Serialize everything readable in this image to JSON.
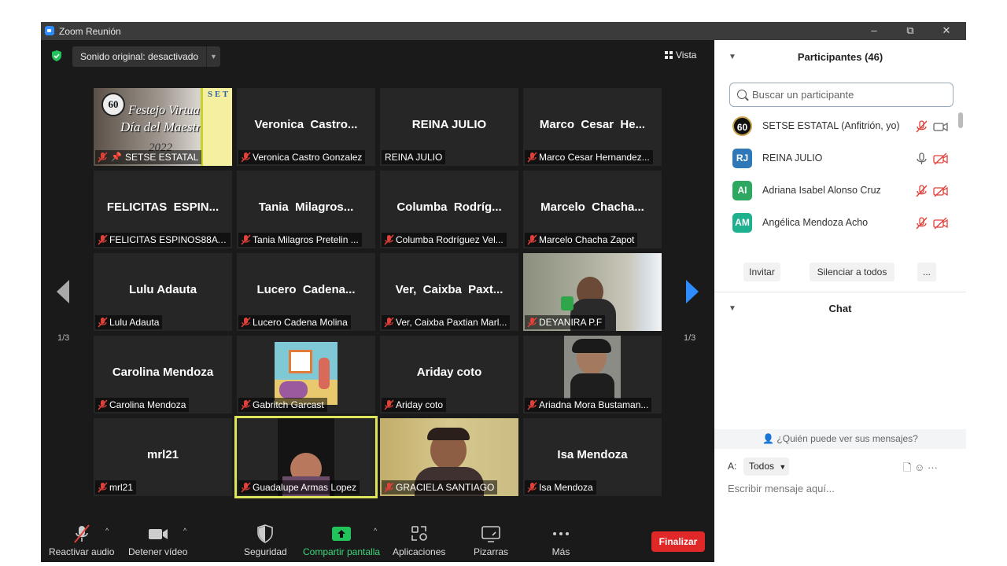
{
  "window": {
    "title": "Zoom Reunión",
    "min": "–",
    "max": "⧉",
    "close": "✕"
  },
  "topbar": {
    "sound_label": "Sonido original: desactivado",
    "vista_label": "Vista"
  },
  "pager": {
    "left": "1/3",
    "right": "1/3"
  },
  "tiles": [
    {
      "name": "",
      "label": "SETSE ESTATAL",
      "pinned": true,
      "muted": true
    },
    {
      "name": "Veronica  Castro...",
      "label": "Veronica Castro Gonzalez",
      "muted": true
    },
    {
      "name": "REINA JULIO",
      "label": "REINA JULIO",
      "muted": false
    },
    {
      "name": "Marco  Cesar  He...",
      "label": "Marco Cesar Hernandez...",
      "muted": true
    },
    {
      "name": "FELICITAS  ESPIN...",
      "label": "FELICITAS ESPINOS88A P...",
      "muted": true
    },
    {
      "name": "Tania  Milagros...",
      "label": "Tania Milagros Pretelin ...",
      "muted": true
    },
    {
      "name": "Columba  Rodríg...",
      "label": "Columba Rodríguez Vel...",
      "muted": true
    },
    {
      "name": "Marcelo  Chacha...",
      "label": "Marcelo Chacha Zapot",
      "muted": true
    },
    {
      "name": "Lulu Adauta",
      "label": "Lulu Adauta",
      "muted": true
    },
    {
      "name": "Lucero  Cadena...",
      "label": "Lucero Cadena Molina",
      "muted": true
    },
    {
      "name": "Ver,  Caixba  Paxt...",
      "label": "Ver, Caixba Paxtian Marl...",
      "muted": true
    },
    {
      "name": "",
      "label": "DEYANIRA P.F",
      "muted": true
    },
    {
      "name": "Carolina Mendoza",
      "label": "Carolina Mendoza",
      "muted": true
    },
    {
      "name": "",
      "label": "Gabritch Garcast",
      "muted": true
    },
    {
      "name": "Ariday coto",
      "label": "Ariday coto",
      "muted": true
    },
    {
      "name": "",
      "label": "Ariadna Mora Bustaman...",
      "muted": true
    },
    {
      "name": "mrl21",
      "label": "mrl21",
      "muted": true
    },
    {
      "name": "",
      "label": "Guadalupe Armas Lopez",
      "muted": true,
      "active": true
    },
    {
      "name": "",
      "label": "GRACIELA SANTIAGO",
      "muted": true
    },
    {
      "name": "Isa Mendoza",
      "label": "Isa Mendoza",
      "muted": true
    }
  ],
  "banner": {
    "sixty": "60",
    "line1": "Festejo Virtual",
    "line2": "Día del Maestro",
    "year": "2022",
    "set": "S E T"
  },
  "toolbar": {
    "audio": "Reactivar audio",
    "video": "Detener vídeo",
    "security": "Seguridad",
    "share": "Compartir pantalla",
    "apps": "Aplicaciones",
    "whiteboards": "Pizarras",
    "more": "Más",
    "end": "Finalizar",
    "caret": "^"
  },
  "participants": {
    "header": "Participantes (46)",
    "search_placeholder": "Buscar un participante",
    "list": [
      {
        "initials": "60",
        "name": "SETSE ESTATAL (Anfitrión, yo)",
        "color": "#111111",
        "mic": "muted",
        "video": "on"
      },
      {
        "initials": "RJ",
        "name": "REINA JULIO",
        "color": "#2f78b7",
        "mic": "on",
        "video": "off"
      },
      {
        "initials": "AI",
        "name": "Adriana Isabel Alonso Cruz",
        "color": "#2ea860",
        "mic": "muted",
        "video": "off"
      },
      {
        "initials": "AM",
        "name": "Angélica Mendoza Acho",
        "color": "#1fb08f",
        "mic": "muted",
        "video": "off"
      }
    ],
    "invite": "Invitar",
    "mute_all": "Silenciar a todos",
    "more": "..."
  },
  "chat": {
    "header": "Chat",
    "who_can_see": "¿Quién puede ver sus mensajes?",
    "to_label": "A:",
    "recipient": "Todos",
    "placeholder": "Escribir mensaje aquí...",
    "icons": "🗋  ☺  ···"
  },
  "colors": {
    "accent": "#2d8cff",
    "end": "#e02828",
    "muted_icon": "#e0403a",
    "share": "#23c35c",
    "active_border": "#dfe55a"
  }
}
